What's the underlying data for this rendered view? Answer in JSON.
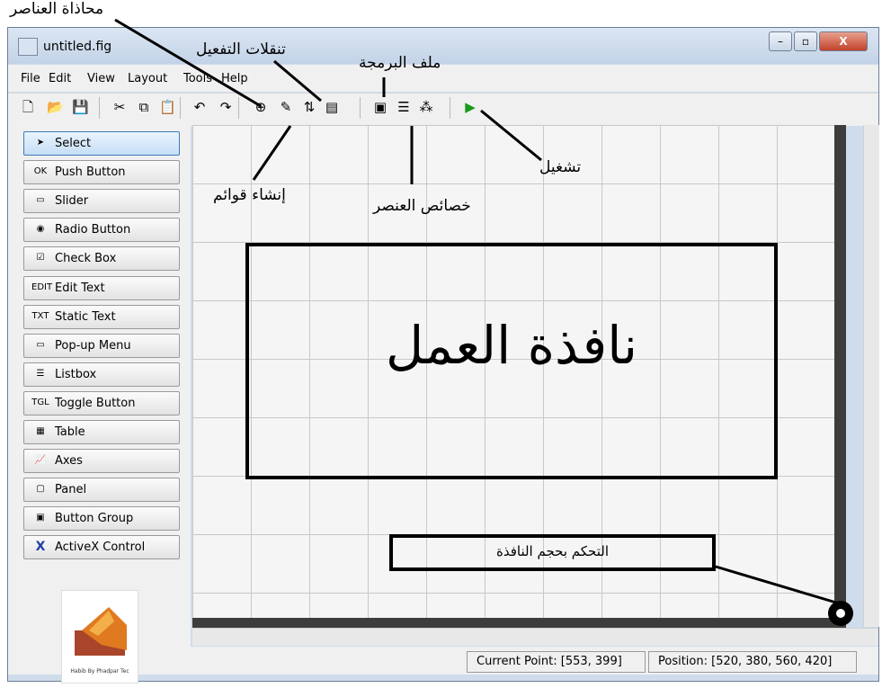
{
  "window": {
    "title": "untitled.fig",
    "minimize": "–",
    "maximize": "▫",
    "close": "X"
  },
  "menu": [
    "File",
    "Edit",
    "View",
    "Layout",
    "Tools",
    "Help"
  ],
  "toolbar": [
    {
      "name": "new-file-icon",
      "glyph": "🗋"
    },
    {
      "name": "open-folder-icon",
      "glyph": "📂"
    },
    {
      "name": "save-icon",
      "glyph": "💾"
    },
    {
      "name": "cut-icon",
      "glyph": "✂"
    },
    {
      "name": "copy-icon",
      "glyph": "⧉"
    },
    {
      "name": "paste-icon",
      "glyph": "📋"
    },
    {
      "name": "undo-icon",
      "glyph": "↶"
    },
    {
      "name": "redo-icon",
      "glyph": "↷"
    },
    {
      "name": "align-objects-icon",
      "glyph": "⊕"
    },
    {
      "name": "menu-editor-icon",
      "glyph": "✎"
    },
    {
      "name": "tab-order-editor-icon",
      "glyph": "⇅"
    },
    {
      "name": "toolbar-editor-icon",
      "glyph": "▤"
    },
    {
      "name": "m-file-editor-icon",
      "glyph": "▣"
    },
    {
      "name": "property-inspector-icon",
      "glyph": "☰"
    },
    {
      "name": "object-browser-icon",
      "glyph": "⁂"
    },
    {
      "name": "run-icon",
      "glyph": "▶",
      "color": "#1a9a1a"
    }
  ],
  "palette": [
    {
      "label": "Select",
      "icon": "➤"
    },
    {
      "label": "Push Button",
      "icon": "OK"
    },
    {
      "label": "Slider",
      "icon": "▭"
    },
    {
      "label": "Radio Button",
      "icon": "◉"
    },
    {
      "label": "Check Box",
      "icon": "☑"
    },
    {
      "label": "Edit Text",
      "icon": "EDIT"
    },
    {
      "label": "Static Text",
      "icon": "TXT"
    },
    {
      "label": "Pop-up Menu",
      "icon": "▭"
    },
    {
      "label": "Listbox",
      "icon": "☰"
    },
    {
      "label": "Toggle Button",
      "icon": "TGL"
    },
    {
      "label": "Table",
      "icon": "▦"
    },
    {
      "label": "Axes",
      "icon": "📈"
    },
    {
      "label": "Panel",
      "icon": "▢"
    },
    {
      "label": "Button Group",
      "icon": "▣"
    },
    {
      "label": "ActiveX Control",
      "icon": "X"
    }
  ],
  "status": {
    "current_point": "Current Point:  [553, 399]",
    "position": "Position: [520, 380, 560, 420]"
  },
  "annotations": {
    "align": "محاذاة العناصر",
    "tab_order": "تنقلات التفعيل",
    "m_file": "ملف البرمجة",
    "menus": "إنشاء قوائم",
    "run": "تشغيل",
    "properties": "خصائص العنصر",
    "work_window": "نافذة العمل",
    "resize": "التحكم بحجم النافذة"
  },
  "logo_text": "Habib By Phadpar Tec"
}
